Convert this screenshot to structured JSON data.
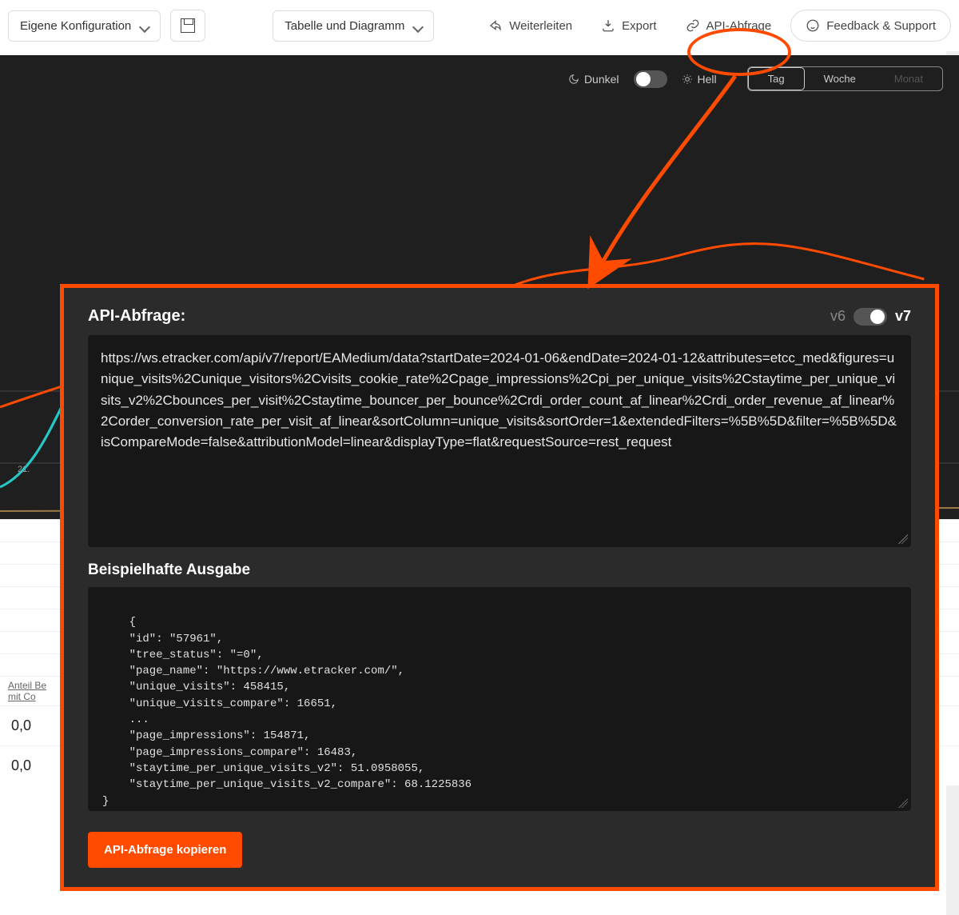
{
  "toolbar": {
    "config_dropdown": "Eigene Konfiguration",
    "view_dropdown": "Tabelle und Diagramm",
    "share": "Weiterleiten",
    "export": "Export",
    "api_query": "API-Abfrage",
    "feedback": "Feedback & Support"
  },
  "chart_controls": {
    "theme_dark": "Dunkel",
    "theme_light": "Hell",
    "period_day": "Tag",
    "period_week": "Woche",
    "period_month": "Monat",
    "axis_date_label": "21."
  },
  "table_area": {
    "label_line1": "Anteil Be",
    "label_line2": "mit Co",
    "value1": "0,0",
    "value2": "0,0"
  },
  "modal": {
    "title": "API-Abfrage:",
    "version_old": "v6",
    "version_new": "v7",
    "url_text": "https://ws.etracker.com/api/v7/report/EAMedium/data?startDate=2024-01-06&endDate=2024-01-12&attributes=etcc_med&figures=unique_visits%2Cunique_visitors%2Cvisits_cookie_rate%2Cpage_impressions%2Cpi_per_unique_visits%2Cstaytime_per_unique_visits_v2%2Cbounces_per_visit%2Cstaytime_bouncer_per_bounce%2Crdi_order_count_af_linear%2Crdi_order_revenue_af_linear%2Corder_conversion_rate_per_visit_af_linear&sortColumn=unique_visits&sortOrder=1&extendedFilters=%5B%5D&filter=%5B%5D&isCompareMode=false&attributionModel=linear&displayType=flat&requestSource=rest_request",
    "output_heading": "Beispielhafte Ausgabe",
    "output_code": "{\n    \"id\": \"57961\",\n    \"tree_status\": \"=0\",\n    \"page_name\": \"https://www.etracker.com/\",\n    \"unique_visits\": 458415,\n    \"unique_visits_compare\": 16651,\n    ...\n    \"page_impressions\": 154871,\n    \"page_impressions_compare\": 16483,\n    \"staytime_per_unique_visits_v2\": 51.0958055,\n    \"staytime_per_unique_visits_v2_compare\": 68.1225836\n}",
    "copy_button": "API-Abfrage kopieren"
  }
}
